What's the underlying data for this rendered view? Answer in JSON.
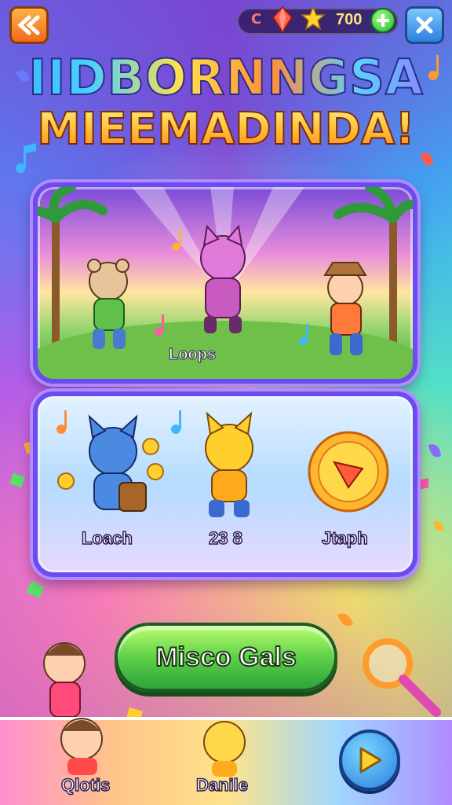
{
  "header": {
    "currency_letter": "C",
    "coins": "700"
  },
  "title": {
    "line1": "IIDBORNNGSA",
    "line2": "MIEEMADINDA!"
  },
  "scene_panel": {
    "label": "Loops"
  },
  "characters": [
    {
      "label": "Loach"
    },
    {
      "label": "23 8"
    },
    {
      "label": "Jtaph"
    }
  ],
  "main_button": {
    "label": "Misco Gals"
  },
  "bottom_bar": {
    "players": [
      {
        "label": "Qlotis"
      },
      {
        "label": "Danile"
      }
    ]
  },
  "icons": {
    "back": "back-arrows-icon",
    "close": "close-icon",
    "gem": "gem-icon",
    "star": "star-icon",
    "plus": "plus-icon",
    "play": "play-icon",
    "magnifier": "magnifier-icon"
  },
  "colors": {
    "accent_orange": "#f06a1a",
    "accent_blue": "#2f7fe0",
    "accent_green": "#2ea33a",
    "panel_border": "#6a4cf0"
  }
}
